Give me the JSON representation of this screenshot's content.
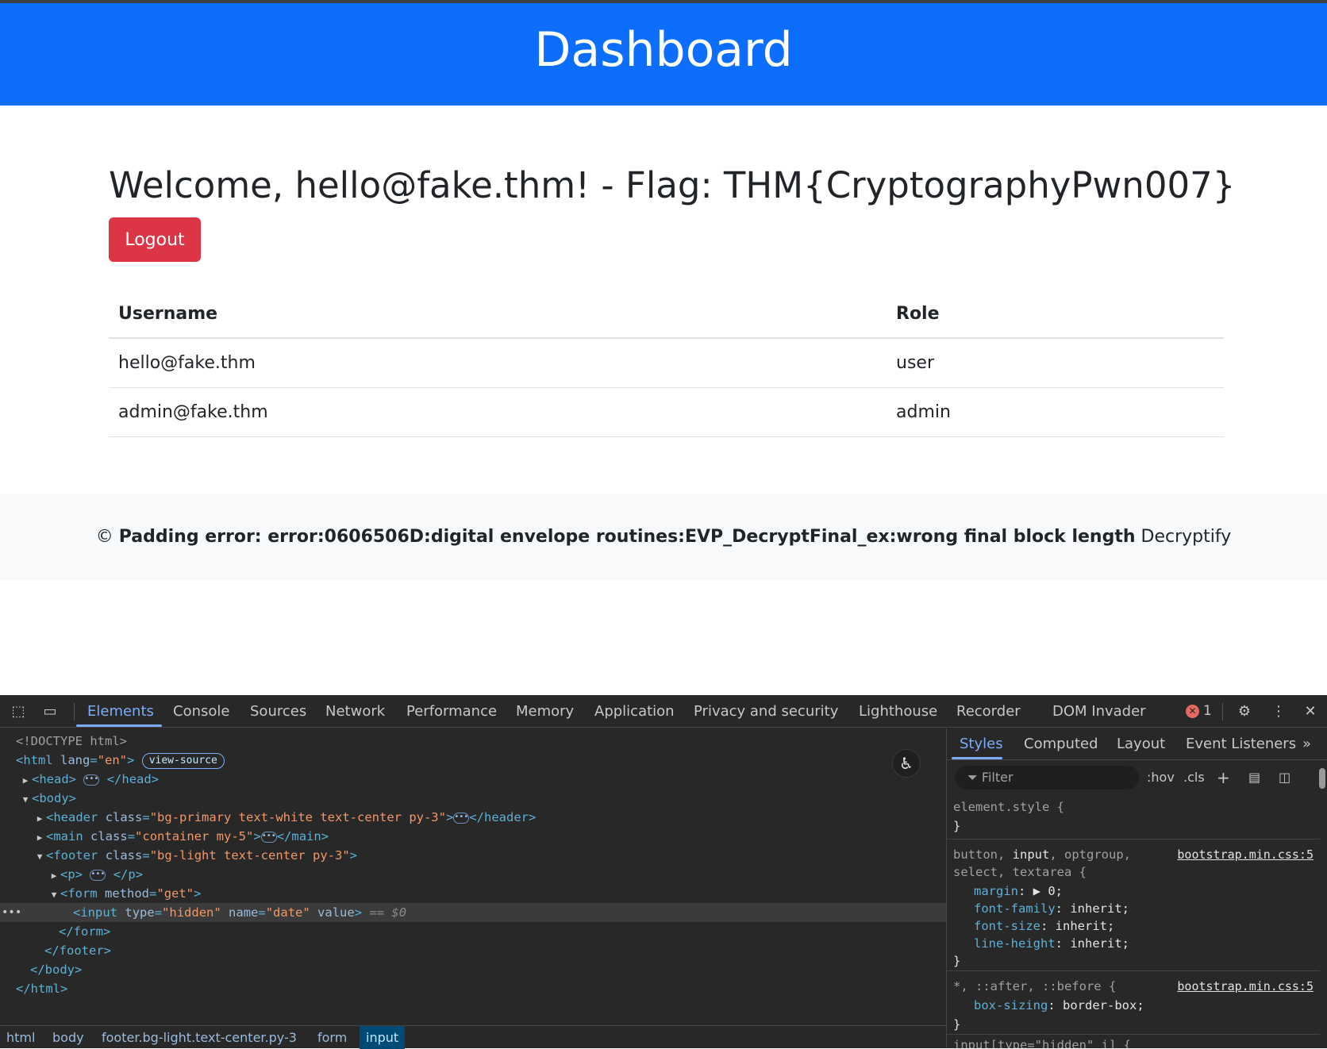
{
  "header": {
    "title": "Dashboard"
  },
  "main": {
    "welcome": "Welcome, hello@fake.thm! - Flag: THM{CryptographyPwn007}",
    "logout_label": "Logout",
    "table": {
      "columns": [
        "Username",
        "Role"
      ],
      "rows": [
        [
          "hello@fake.thm",
          "user"
        ],
        [
          "admin@fake.thm",
          "admin"
        ]
      ]
    }
  },
  "footer": {
    "copyright": "©",
    "error_text": "Padding error: error:0606506D:digital envelope routines:EVP_DecryptFinal_ex:wrong final block length",
    "brand": "Decryptify"
  },
  "devtools": {
    "tabs": [
      "Elements",
      "Console",
      "Sources",
      "Network",
      "Performance",
      "Memory",
      "Application",
      "Privacy and security",
      "Lighthouse",
      "Recorder",
      "DOM Invader"
    ],
    "active_tab": "Elements",
    "error_count": "1",
    "dom": {
      "doctype": "<!DOCTYPE html>",
      "html_open": "html",
      "lang_attr": "lang",
      "lang_val": "\"en\"",
      "view_source": "view-source",
      "head": "head",
      "body": "body",
      "header_tag": "header",
      "header_class_val": "\"bg-primary text-white text-center py-3\"",
      "main_tag": "main",
      "main_class_val": "\"container my-5\"",
      "footer_tag": "footer",
      "footer_class_val": "\"bg-light text-center py-3\"",
      "p_tag": "p",
      "form_tag": "form",
      "method_attr": "method",
      "method_val": "\"get\"",
      "input_tag": "input",
      "type_attr": "type",
      "type_val": "\"hidden\"",
      "name_attr": "name",
      "name_val": "\"date\"",
      "value_attr": "value",
      "class_attr": "class",
      "selected_marker": "== $0"
    },
    "breadcrumbs": [
      "html",
      "body",
      "footer.bg-light.text-center.py-3",
      "form",
      "input"
    ],
    "styles": {
      "tabs": [
        "Styles",
        "Computed",
        "Layout",
        "Event Listeners"
      ],
      "filter_placeholder": "Filter",
      "hov": ":hov",
      "cls": ".cls",
      "element_style": "element.style {",
      "rule1_selector_a": "button, ",
      "rule1_selector_b": "input",
      "rule1_selector_c": ", optgroup,",
      "rule1_selector_d": "select, textarea {",
      "rule1_source": "bootstrap.min.css:5",
      "rule1_props": [
        [
          "margin",
          "0;"
        ],
        [
          "font-family",
          "inherit;"
        ],
        [
          "font-size",
          "inherit;"
        ],
        [
          "line-height",
          "inherit;"
        ]
      ],
      "rule2_selector": "*, ::after, ::before {",
      "rule2_source": "bootstrap.min.css:5",
      "rule2_props": [
        [
          "box-sizing",
          "border-box;"
        ]
      ],
      "rule3_partial": "input[type=\"hidden\" i] {"
    }
  }
}
